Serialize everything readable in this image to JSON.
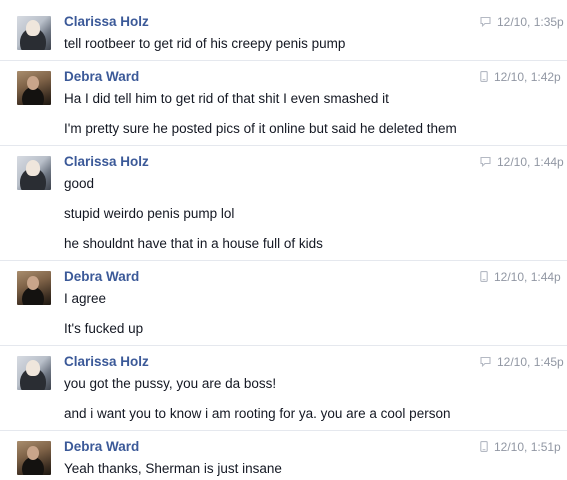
{
  "messages": [
    {
      "sender": "Clarissa Holz",
      "avatar": "clarissa-avatar",
      "timestamp": "12/10, 1:35p",
      "source_icon": "chat-bubble-icon",
      "lines": [
        "tell rootbeer to get rid of his creepy penis pump"
      ]
    },
    {
      "sender": "Debra Ward",
      "avatar": "debra-avatar",
      "timestamp": "12/10, 1:42p",
      "source_icon": "mobile-phone-icon",
      "lines": [
        "Ha I did tell him to get rid of that shit I even smashed it",
        "I'm pretty sure he posted pics of it online but said he deleted them"
      ]
    },
    {
      "sender": "Clarissa Holz",
      "avatar": "clarissa-avatar",
      "timestamp": "12/10, 1:44p",
      "source_icon": "chat-bubble-icon",
      "lines": [
        "good",
        "stupid weirdo penis pump lol",
        "he shouldnt have that in a house full of kids"
      ]
    },
    {
      "sender": "Debra Ward",
      "avatar": "debra-avatar",
      "timestamp": "12/10, 1:44p",
      "source_icon": "mobile-phone-icon",
      "lines": [
        "I agree",
        "It's fucked up"
      ]
    },
    {
      "sender": "Clarissa Holz",
      "avatar": "clarissa-avatar",
      "timestamp": "12/10, 1:45p",
      "source_icon": "chat-bubble-icon",
      "lines": [
        "you got the pussy, you are da boss!",
        "and i want you to know i am rooting for ya. you are a cool person"
      ]
    },
    {
      "sender": "Debra Ward",
      "avatar": "debra-avatar",
      "timestamp": "12/10, 1:51p",
      "source_icon": "mobile-phone-icon",
      "lines": [
        "Yeah thanks, Sherman is just insane"
      ]
    }
  ]
}
